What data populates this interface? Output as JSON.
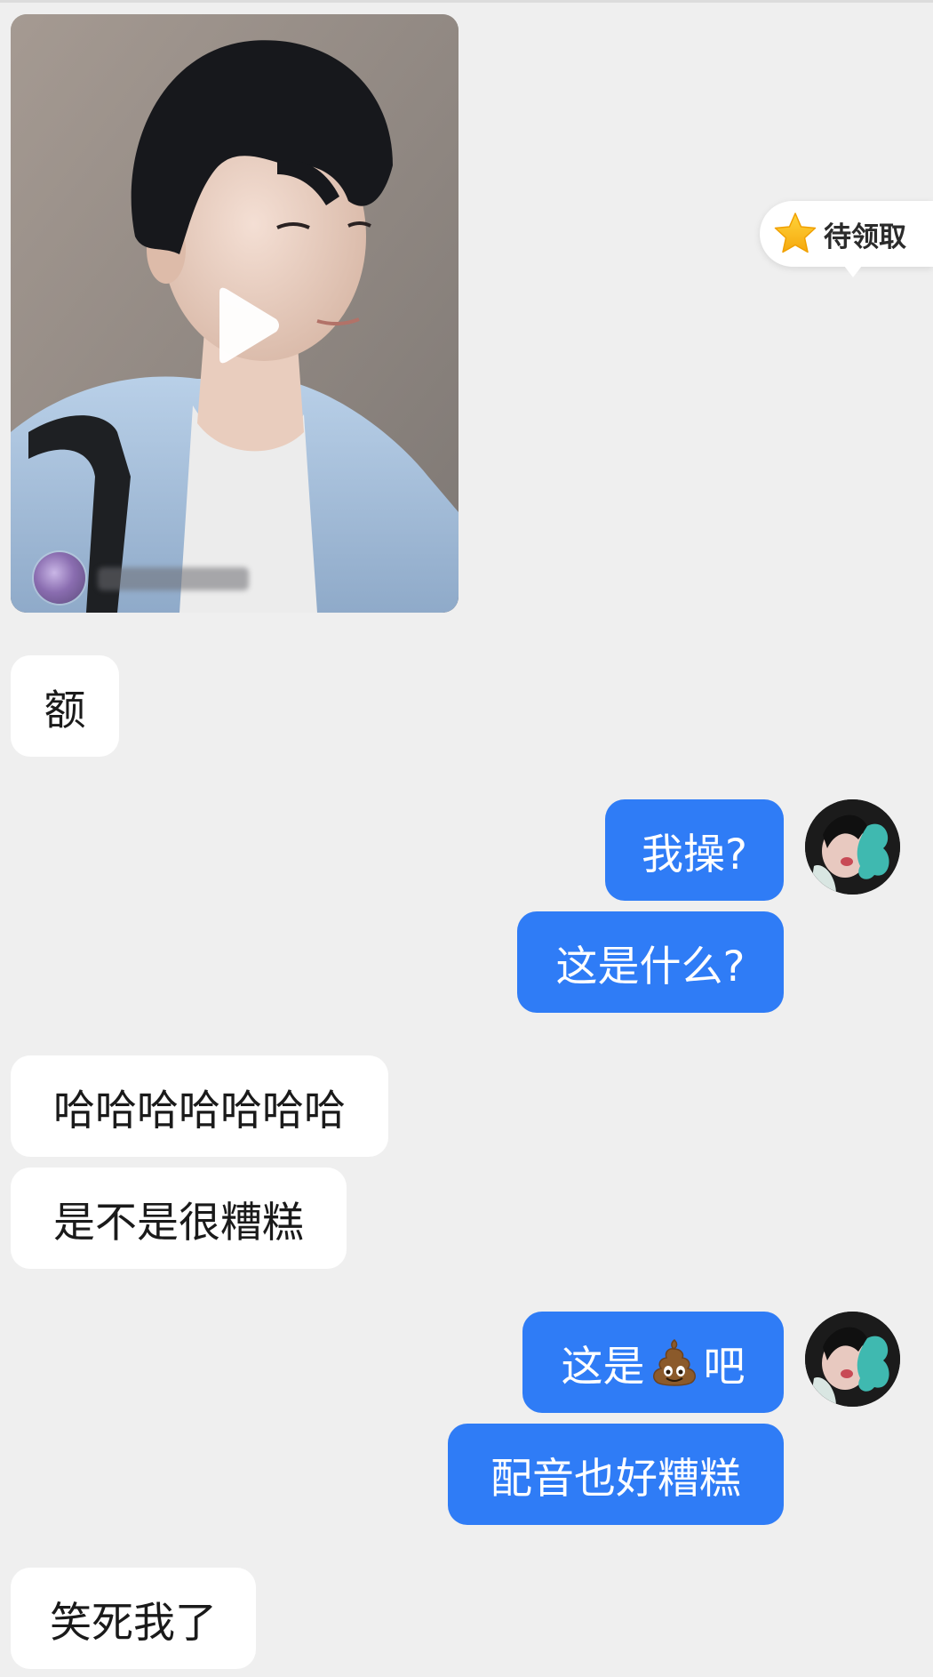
{
  "video_message": {
    "play_icon": "play-icon"
  },
  "reward_tag": {
    "icon": "star-icon",
    "label": "待领取"
  },
  "messages": [
    {
      "side": "left",
      "text": "额"
    },
    {
      "side": "right",
      "text": "我操?"
    },
    {
      "side": "right",
      "text": "这是什么?"
    },
    {
      "side": "left",
      "text": "哈哈哈哈哈哈哈"
    },
    {
      "side": "left",
      "text": "是不是很糟糕"
    },
    {
      "side": "right",
      "text_before": "这是",
      "emoji": "pile-of-poo",
      "text_after": "吧"
    },
    {
      "side": "right",
      "text": "配音也好糟糕"
    },
    {
      "side": "left",
      "text": "笑死我了"
    }
  ],
  "colors": {
    "background": "#EFEFEF",
    "incoming_bubble": "#FFFFFF",
    "outgoing_bubble": "#2F7CF6",
    "incoming_text": "#1A1A1A",
    "outgoing_text": "#FFFFFF"
  }
}
